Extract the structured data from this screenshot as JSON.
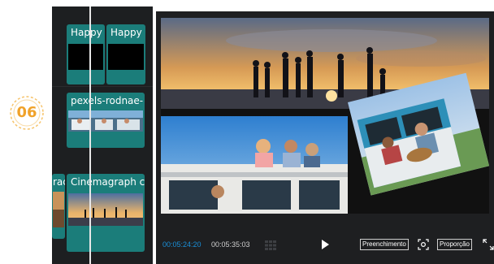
{
  "badge": {
    "number": "06",
    "color": "#f0a22a"
  },
  "timeline": {
    "clips": [
      {
        "label": "Happy"
      },
      {
        "label": "Happy"
      },
      {
        "label": "pexels-rodnae-"
      },
      {
        "label": "rac"
      },
      {
        "label": "Cinemagraph c"
      }
    ]
  },
  "player": {
    "current_time": "00:05:24:20",
    "total_time": "00:05:35:03",
    "fill_label": "Preenchimento",
    "ratio_label": "Proporção"
  },
  "icons": {
    "grid": "grid-icon",
    "play": "play-icon",
    "focus": "focus-icon",
    "expand": "expand-icon"
  },
  "colors": {
    "accent": "#1a8fd8",
    "clip": "#1b7d7a",
    "badge": "#f0a22a"
  }
}
